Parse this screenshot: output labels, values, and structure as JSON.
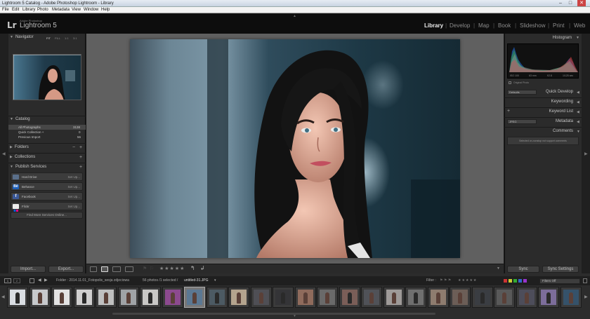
{
  "window": {
    "title": "Lightroom 5 Catalog - Adobe Photoshop Lightroom - Library"
  },
  "menu": [
    "File",
    "Edit",
    "Library",
    "Photo",
    "Metadata",
    "View",
    "Window",
    "Help"
  ],
  "identity": {
    "small": "Adobe Photoshop",
    "product": "Lightroom 5",
    "logo": "Lr"
  },
  "modules": [
    {
      "label": "Library",
      "active": true
    },
    {
      "label": "Develop"
    },
    {
      "label": "Map"
    },
    {
      "label": "Book"
    },
    {
      "label": "Slideshow"
    },
    {
      "label": "Print"
    },
    {
      "label": "Web"
    }
  ],
  "navigator": {
    "title": "Navigator",
    "zooms": [
      "FIT",
      "FILL",
      "1:1",
      "3:1"
    ]
  },
  "catalog": {
    "title": "Catalog",
    "rows": [
      {
        "label": "All Photographs",
        "count": "3138"
      },
      {
        "label": "Quick Collection +",
        "count": "0"
      },
      {
        "label": "Previous Import",
        "count": "56"
      }
    ]
  },
  "folders": {
    "title": "Folders"
  },
  "collections": {
    "title": "Collections"
  },
  "publish": {
    "title": "Publish Services",
    "services": [
      {
        "label": "Hard Drive",
        "action": "Set Up...",
        "color": "#5a6f8a"
      },
      {
        "label": "Behance",
        "action": "Set Up...",
        "color": "#1e5fb8"
      },
      {
        "label": "Facebook",
        "action": "Set Up...",
        "color": "#3b5998"
      },
      {
        "label": "Flickr",
        "action": "Set Up...",
        "color": "#c42b6f"
      }
    ],
    "more": "Find More Services Online..."
  },
  "left_buttons": {
    "import": "Import...",
    "export": "Export..."
  },
  "right": {
    "histogram": "Histogram",
    "histo_vals": [
      "ISO 100",
      "63 mm",
      "f/2.8",
      "1/125 sec"
    ],
    "original_photo": "Original Photo",
    "defaults": "Defaults",
    "quick_develop": "Quick Develop",
    "keywording": "Keywording",
    "keyword_list": "Keyword List",
    "jpeg": "JPEG",
    "metadata": "Metadata",
    "comments": "Comments",
    "comments_note": "Selected on-nonstop not support comments",
    "sync": "Sync",
    "sync_settings": "Sync Settings"
  },
  "filmstrip": {
    "pages": [
      "1",
      "2"
    ],
    "path": "Folder : 2014.11.01_Fotopolis_sesja zdjeciowa",
    "count": "56 photos /1 selected /",
    "file": "untitled-31.JPG",
    "filter_label": "Filter :",
    "filters_off": "Filters Off"
  },
  "colors": {
    "accent": "#eeeeee",
    "panel": "#2b2b2b",
    "bg": "#1b1b1b"
  },
  "thumb_tones": [
    "#d9dde2",
    "#c7c9cc",
    "#e3e3e3",
    "#d0cfcf",
    "#bfc0c0",
    "#9fa3a6",
    "#c9c8c6",
    "#8c4a8f",
    "#5b7893",
    "#4c5a63",
    "#b4a48e",
    "#4f4f55",
    "#343437",
    "#8f6b5c",
    "#6a6a6a",
    "#7a5e58",
    "#505258",
    "#9e9a98",
    "#6f6f6f",
    "#8e7c6f",
    "#6c5e57",
    "#3a3d42",
    "#595959",
    "#4d4d5a",
    "#7c6d9a",
    "#35526a",
    "#4a5a70",
    "#666666",
    "#4f6e86",
    "#3e3e48"
  ]
}
